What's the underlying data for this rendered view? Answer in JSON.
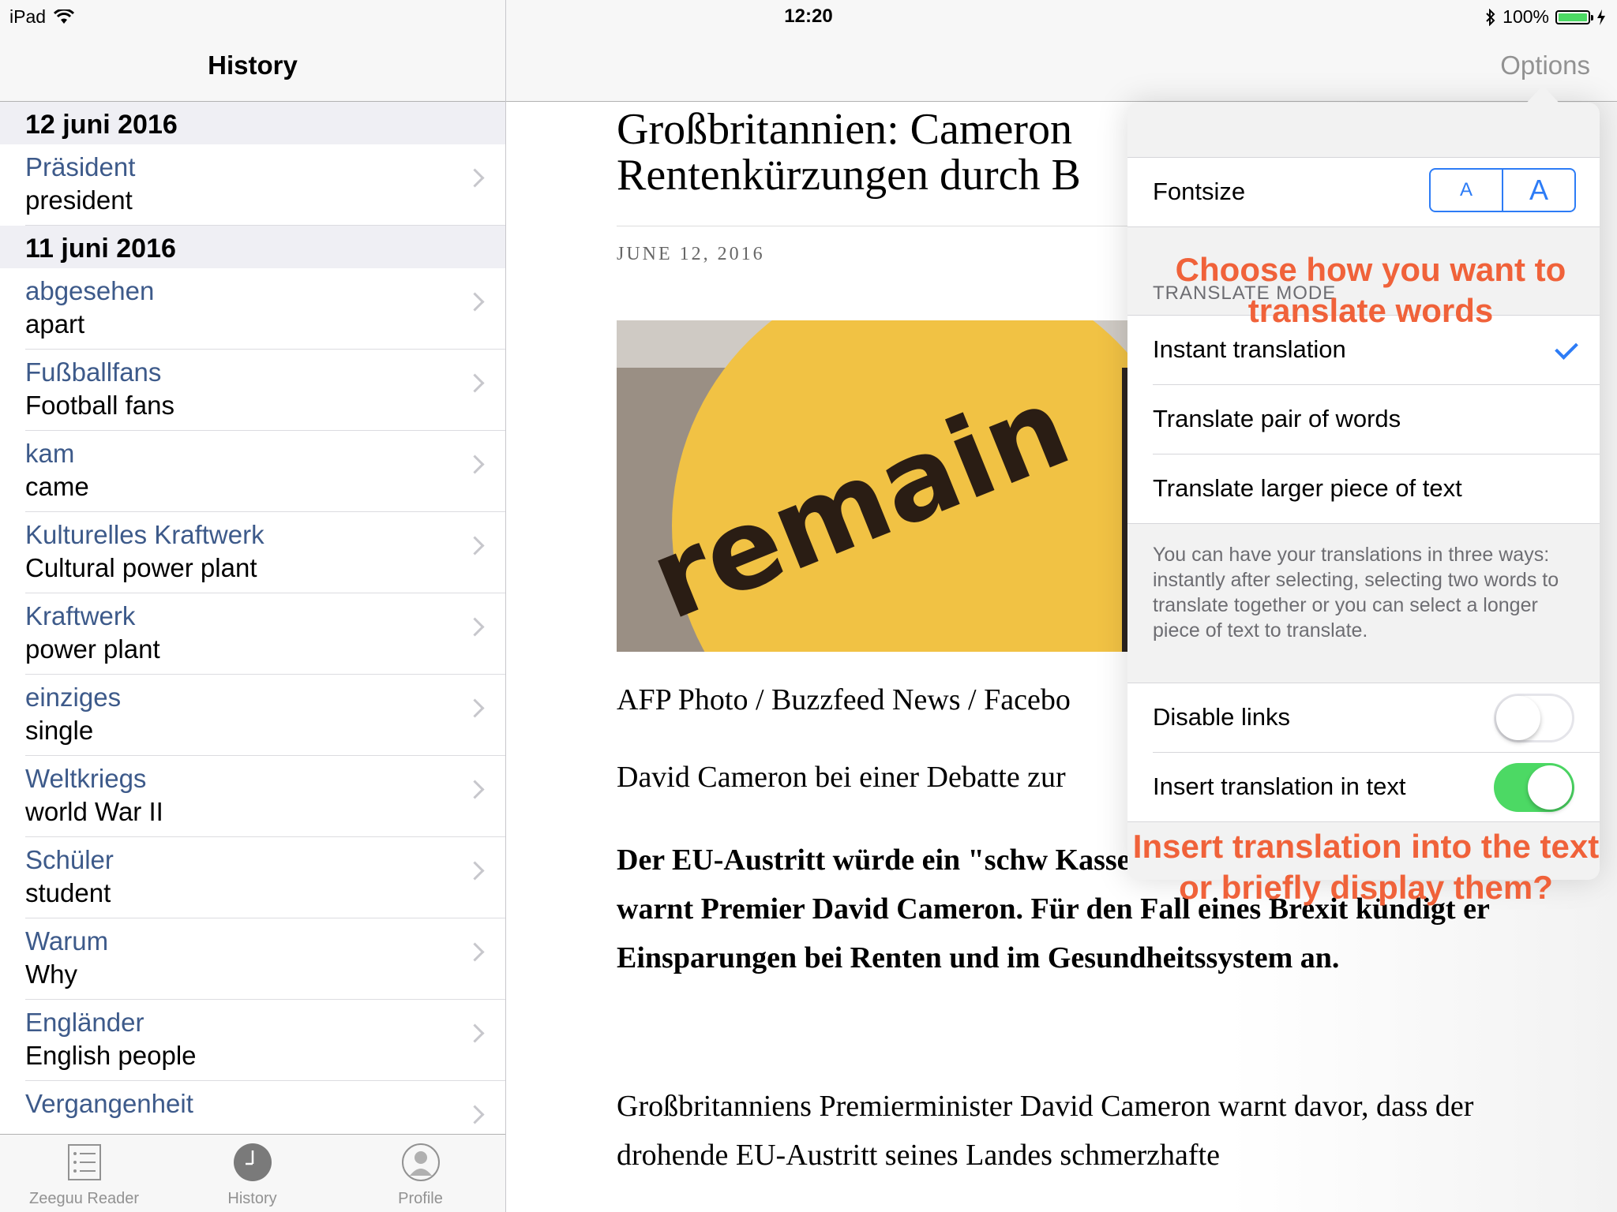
{
  "status_bar": {
    "device": "iPad",
    "time": "12:20",
    "battery": "100%",
    "battery_level": 1.0
  },
  "left_panel": {
    "title": "History",
    "sections": [
      {
        "date": "12 juni 2016",
        "items": [
          {
            "word": "Präsident",
            "translation": "president"
          }
        ]
      },
      {
        "date": "11 juni 2016",
        "items": [
          {
            "word": "abgesehen",
            "translation": "apart"
          },
          {
            "word": "Fußballfans",
            "translation": "Football fans"
          },
          {
            "word": "kam",
            "translation": "came"
          },
          {
            "word": "Kulturelles Kraftwerk",
            "translation": "Cultural power plant"
          },
          {
            "word": "Kraftwerk",
            "translation": "power plant"
          },
          {
            "word": "einziges",
            "translation": "single"
          },
          {
            "word": "Weltkriegs",
            "translation": "world War II"
          },
          {
            "word": "Schüler",
            "translation": "student"
          },
          {
            "word": "Warum",
            "translation": "Why"
          },
          {
            "word": "Engländer",
            "translation": "English people"
          },
          {
            "word": "Vergangenheit",
            "translation": ""
          }
        ]
      }
    ],
    "tabs": [
      {
        "label": "Zeeguu Reader",
        "icon": "list-icon"
      },
      {
        "label": "History",
        "icon": "clock-icon"
      },
      {
        "label": "Profile",
        "icon": "person-icon"
      }
    ]
  },
  "article": {
    "options_label": "Options",
    "title_line1": "Großbritannien: Cameron",
    "title_line2": "Rentenkürzungen durch B",
    "date": "JUNE 12, 2016",
    "image_text": "remain",
    "credit": "AFP Photo / Buzzfeed News / Facebo",
    "caption": "David Cameron bei einer Debatte zur",
    "lead": "Der EU-Austritt würde ein \"schw Kassen Großbritanniens spülen, warnt Premier David Cameron. Für den Fall eines Brexit kündigt er Einsparungen bei Renten und im Gesundheitssystem an.",
    "body": "Großbritanniens Premierminister David Cameron warnt davor, dass der drohende EU-Austritt seines Landes schmerzhafte"
  },
  "options_popover": {
    "fontsize_label": "Fontsize",
    "font_small": "A",
    "font_large": "A",
    "translate_mode_header": "TRANSLATE MODE",
    "modes": [
      {
        "label": "Instant translation",
        "selected": true
      },
      {
        "label": "Translate pair of words",
        "selected": false
      },
      {
        "label": "Translate larger piece of text",
        "selected": false
      }
    ],
    "footer": "You can have your translations in three ways: instantly after selecting, selecting two words to translate together or you can select a longer piece of text to translate.",
    "toggles": [
      {
        "label": "Disable links",
        "on": false
      },
      {
        "label": "Insert translation in text",
        "on": true
      }
    ]
  },
  "annotations": {
    "translate_hint": "Choose how you want to translate words",
    "insert_hint": "Insert translation into the text or briefly display them?"
  },
  "colors": {
    "accent": "#2d7cf6",
    "link_word": "#3d5a8a",
    "annotation": "#f0623a",
    "toggle_on": "#4cd964"
  }
}
